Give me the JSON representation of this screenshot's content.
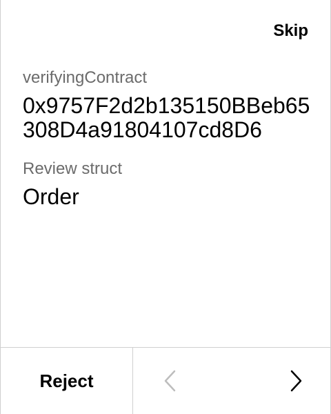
{
  "header": {
    "skip_label": "Skip"
  },
  "fields": [
    {
      "label": "verifyingContract",
      "value": "0x9757F2d2b135150BBeb65308D4a91804107cd8D6"
    },
    {
      "label": "Review struct",
      "value": "Order"
    }
  ],
  "footer": {
    "reject_label": "Reject",
    "prev_icon": "chevron-left-icon",
    "next_icon": "chevron-right-icon",
    "prev_enabled": false,
    "next_enabled": true
  },
  "colors": {
    "text": "#000000",
    "label": "#6b6b6b",
    "divider": "#cfcfcf",
    "disabled_icon": "#bdbdbd"
  }
}
